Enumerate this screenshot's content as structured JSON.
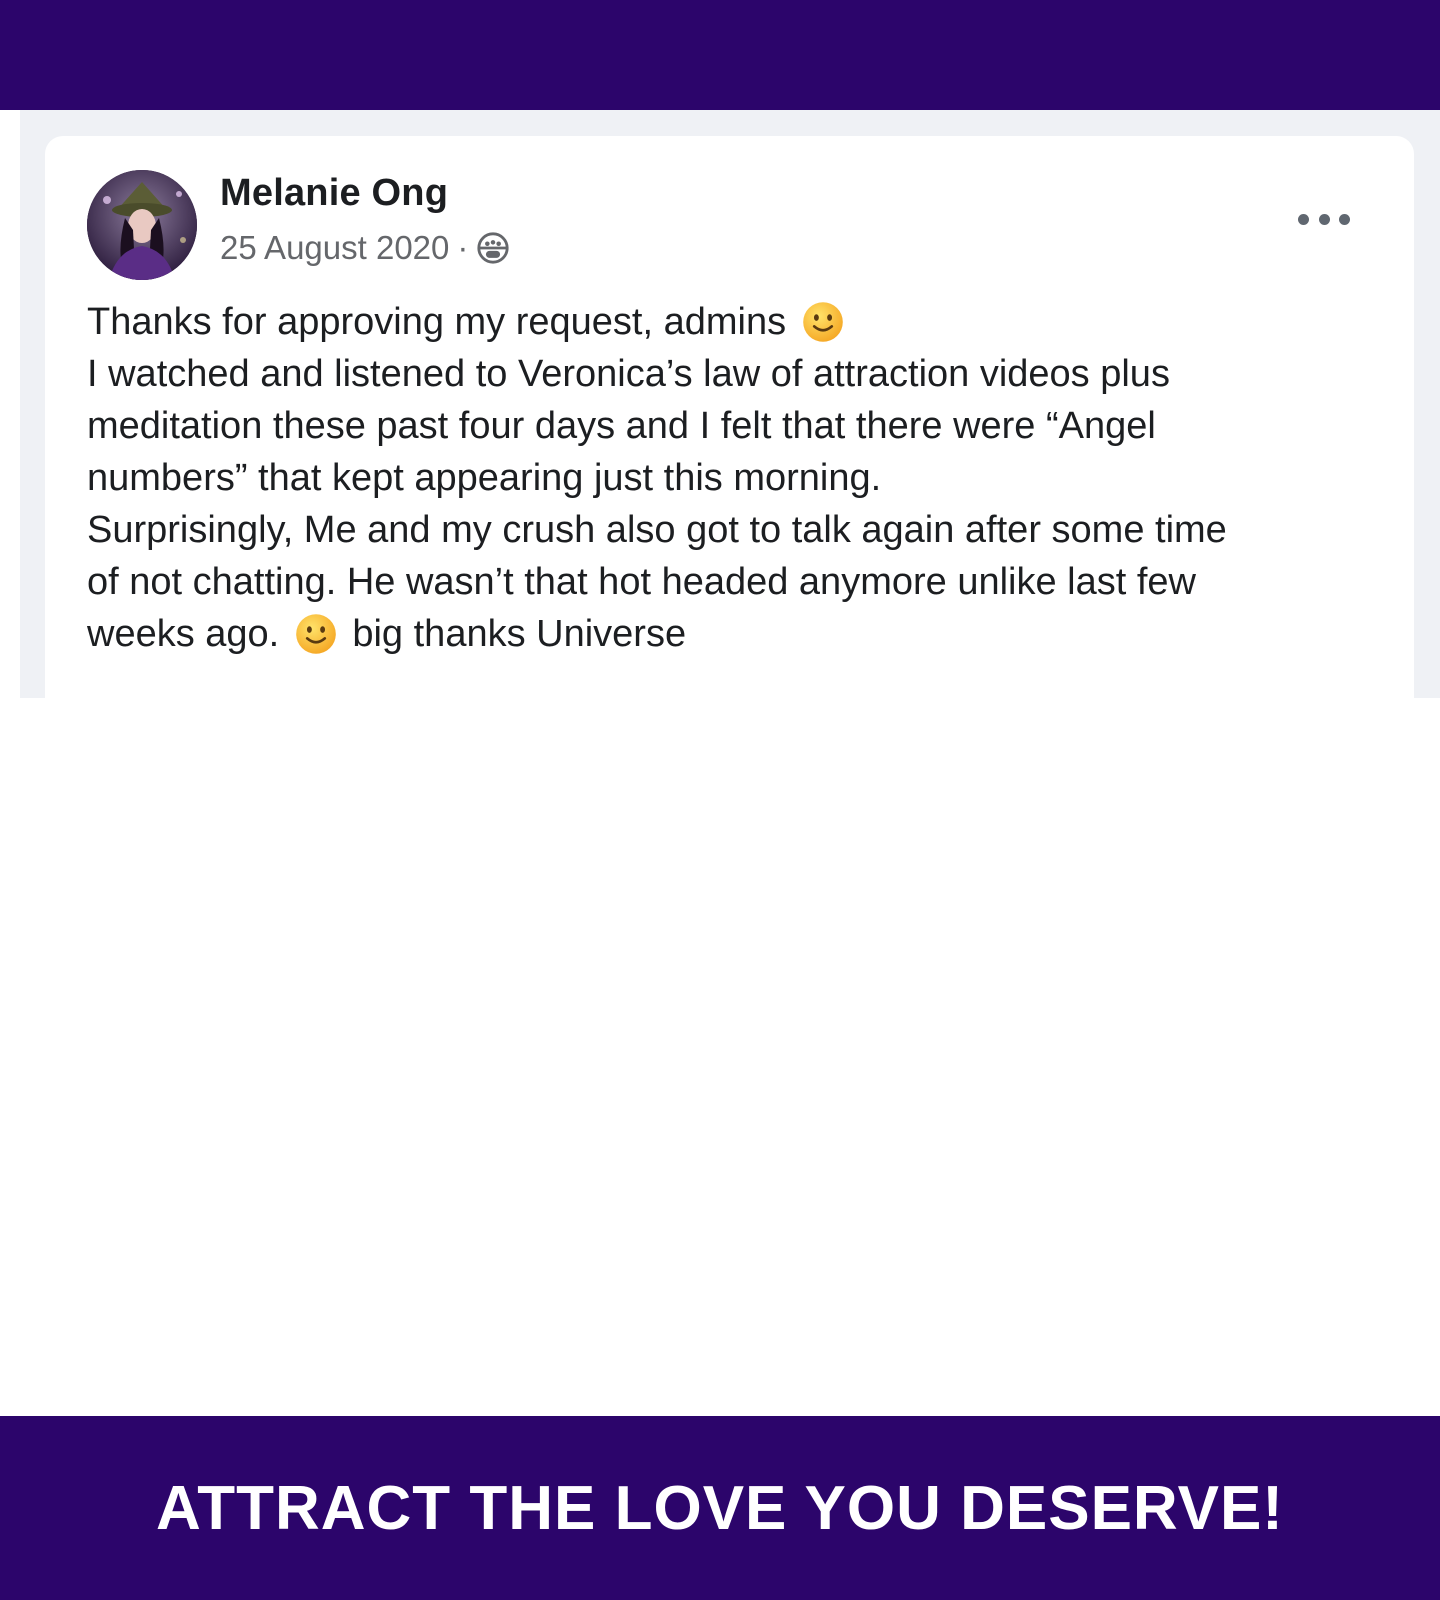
{
  "post": {
    "author": "Melanie Ong",
    "date": "25 August 2020",
    "separator": "·",
    "audience_icon": "public-globe-icon",
    "lines": [
      {
        "text": "Thanks for approving my request, admins",
        "emoji_after": "slightly-smiling-face"
      },
      {
        "text": "I watched and listened to Veronica’s law of attraction videos plus"
      },
      {
        "text": "meditation these past four days and I felt that there were “Angel"
      },
      {
        "text": "numbers” that kept appearing just this morning."
      },
      {
        "text": "Surprisingly, Me and my crush also got to talk again after some time"
      },
      {
        "text": "of not chatting. He wasn’t that hot headed anymore unlike last few"
      },
      {
        "text_before": "weeks ago.",
        "emoji_middle": "slightly-smiling-face",
        "text_after": "big thanks Universe"
      }
    ]
  },
  "banner": {
    "cta": "ATTRACT THE LOVE YOU DESERVE!"
  },
  "colors": {
    "banner_bg": "#2c056b",
    "feed_bg": "#eff1f5",
    "card_bg": "#ffffff",
    "text_primary": "#1c1e21",
    "text_secondary": "#65676b"
  }
}
